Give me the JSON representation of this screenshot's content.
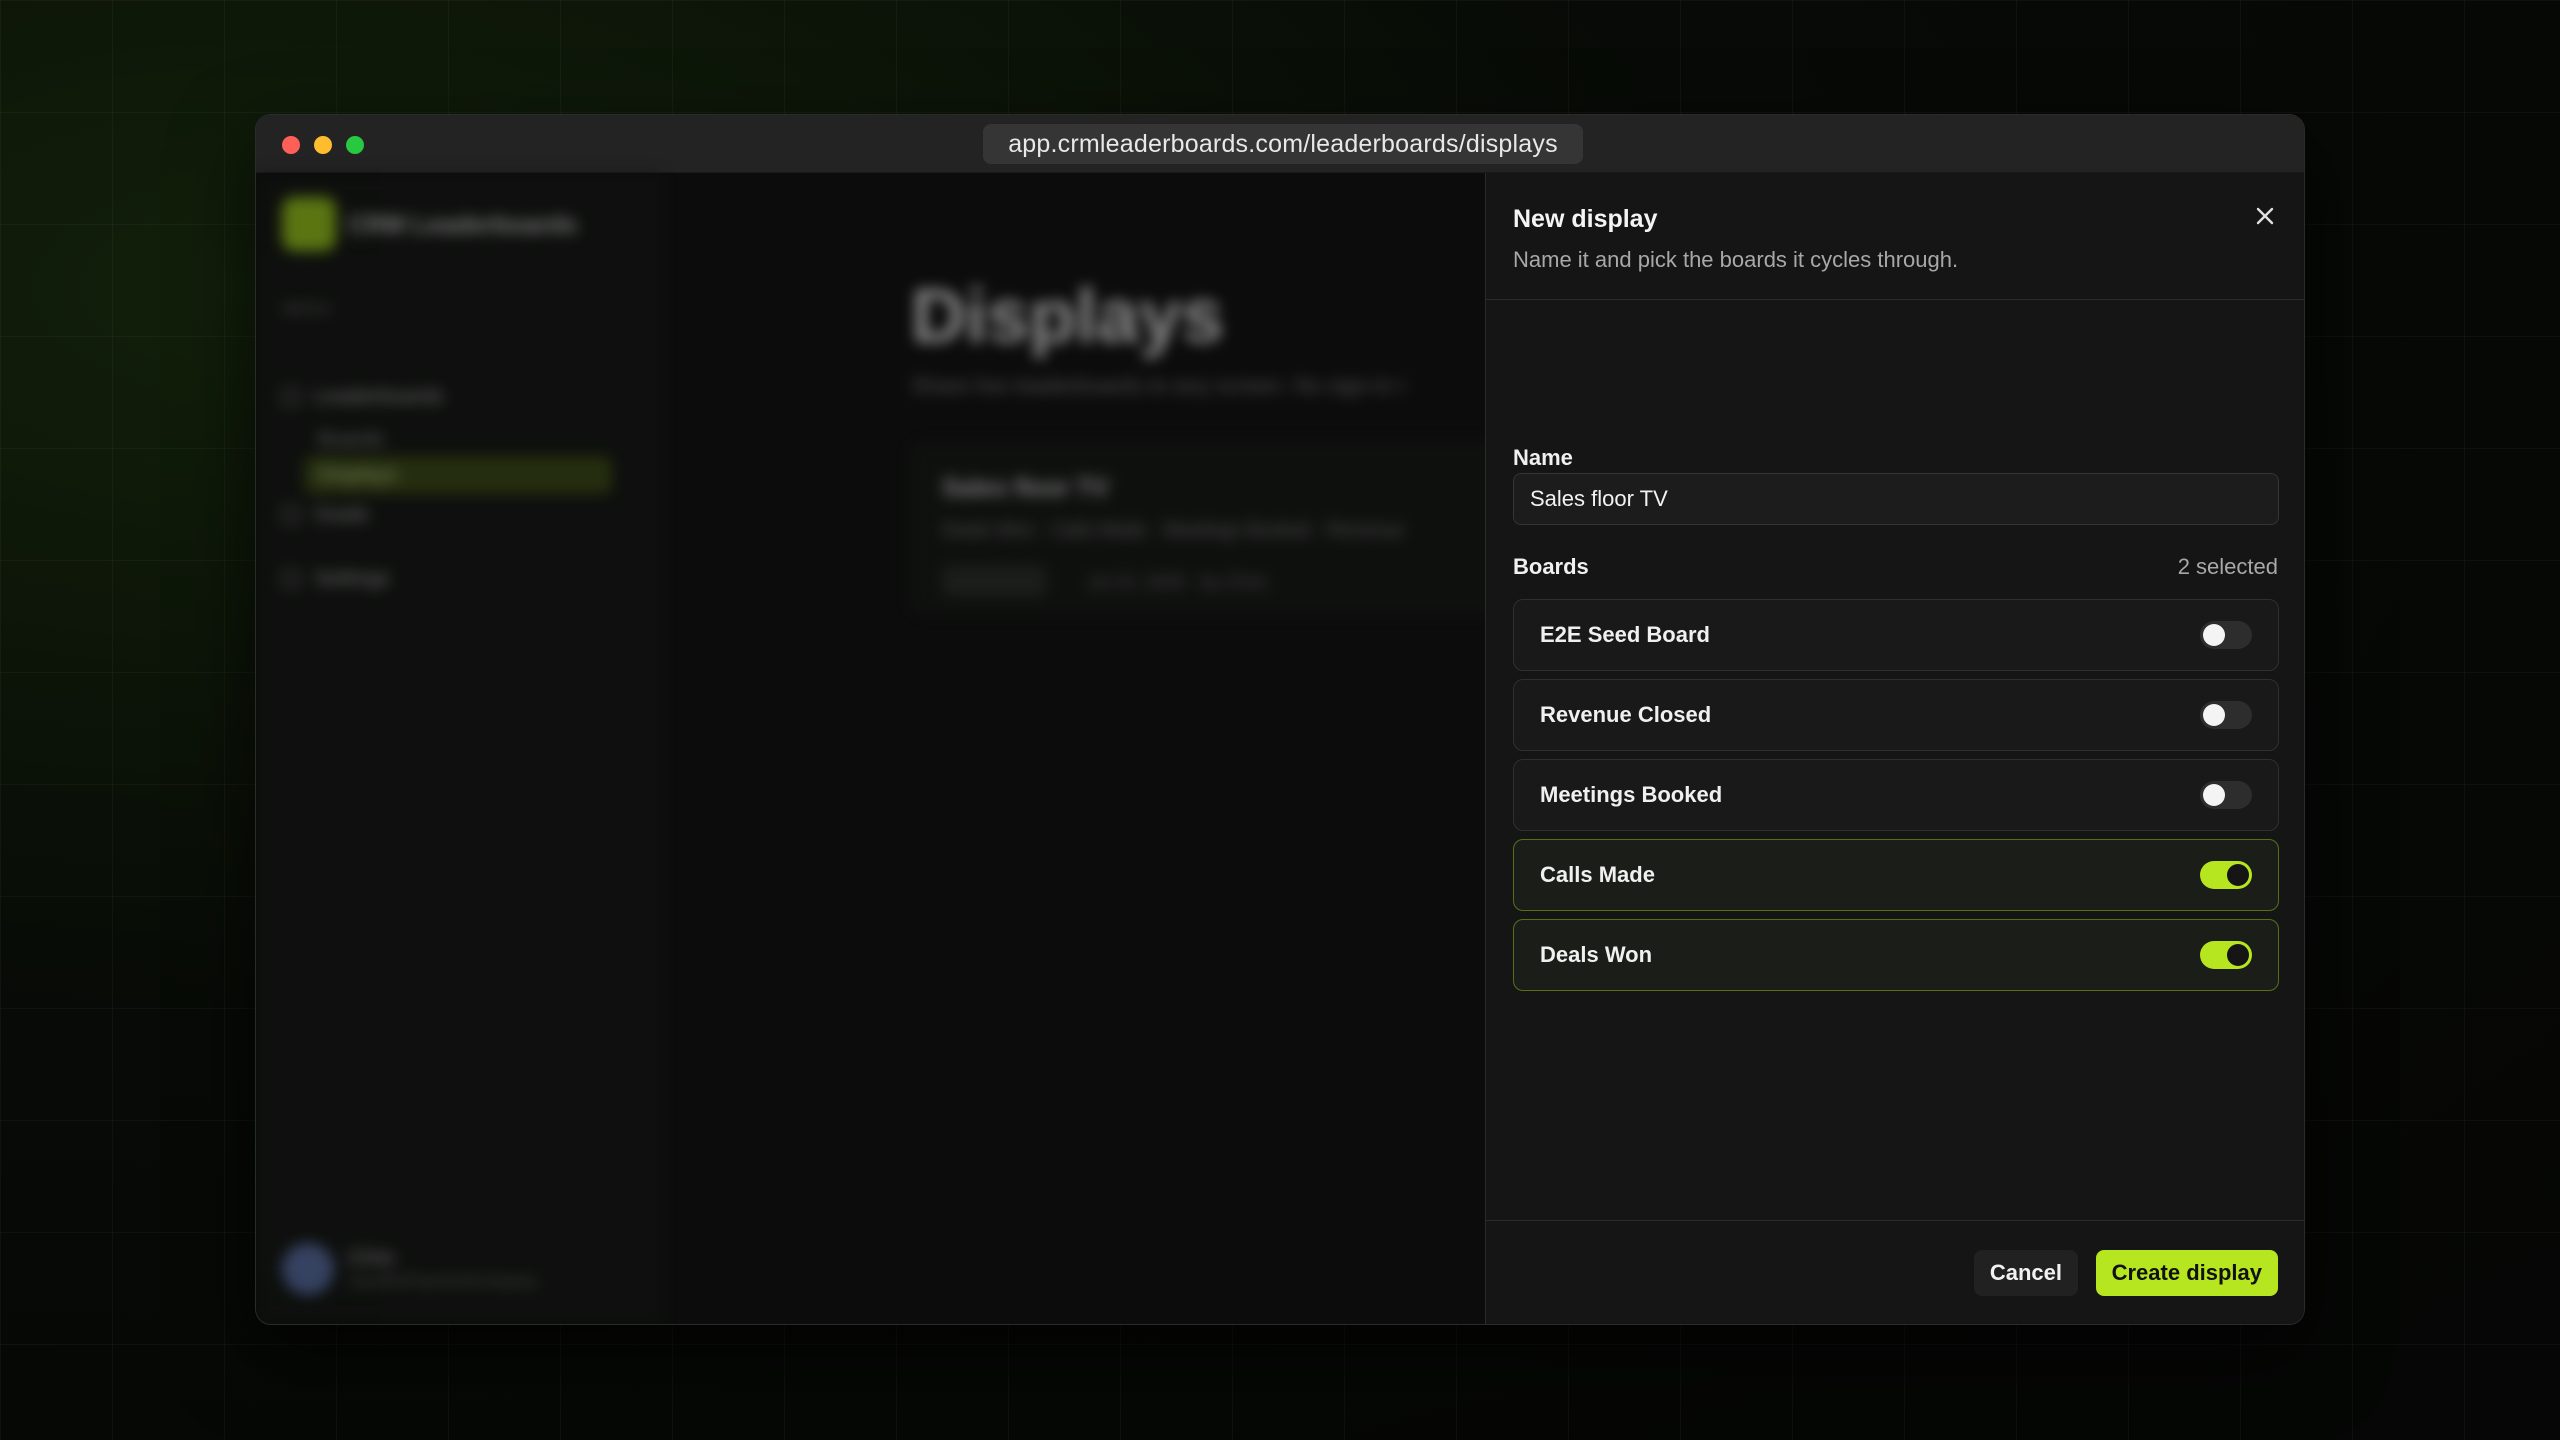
{
  "window": {
    "url": "app.crmleaderboards.com/leaderboards/displays"
  },
  "background_app": {
    "brand": "CRM Leaderboards",
    "menu_heading": "MENU",
    "nav": {
      "leaderboards": "Leaderboards",
      "boards": "Boards",
      "displays": "Displays",
      "goals": "Goals",
      "settings": "Settings"
    },
    "user": {
      "name": "Chris",
      "org": "SaaSforPaymentCompany"
    },
    "page_title": "Displays",
    "page_subtitle": "Share live leaderboards to any screen. No sign-in r",
    "card": {
      "title": "Sales floor TV",
      "meta": "Deals Won · Calls Made · Meetings Booked · Revenue",
      "date": "Jul 15, 2026 · by Chris"
    }
  },
  "drawer": {
    "title": "New display",
    "subtitle": "Name it and pick the boards it cycles through.",
    "name_label": "Name",
    "name_value": "Sales floor TV",
    "boards_label": "Boards",
    "selected_count": "2 selected",
    "boards": [
      {
        "label": "E2E Seed Board",
        "enabled": false
      },
      {
        "label": "Revenue Closed",
        "enabled": false
      },
      {
        "label": "Meetings Booked",
        "enabled": false
      },
      {
        "label": "Calls Made",
        "enabled": true
      },
      {
        "label": "Deals Won",
        "enabled": true
      }
    ],
    "cancel_label": "Cancel",
    "create_label": "Create display"
  },
  "colors": {
    "accent": "#b6e61f",
    "window_bg": "#0b0c0b",
    "drawer_bg": "#141514"
  }
}
